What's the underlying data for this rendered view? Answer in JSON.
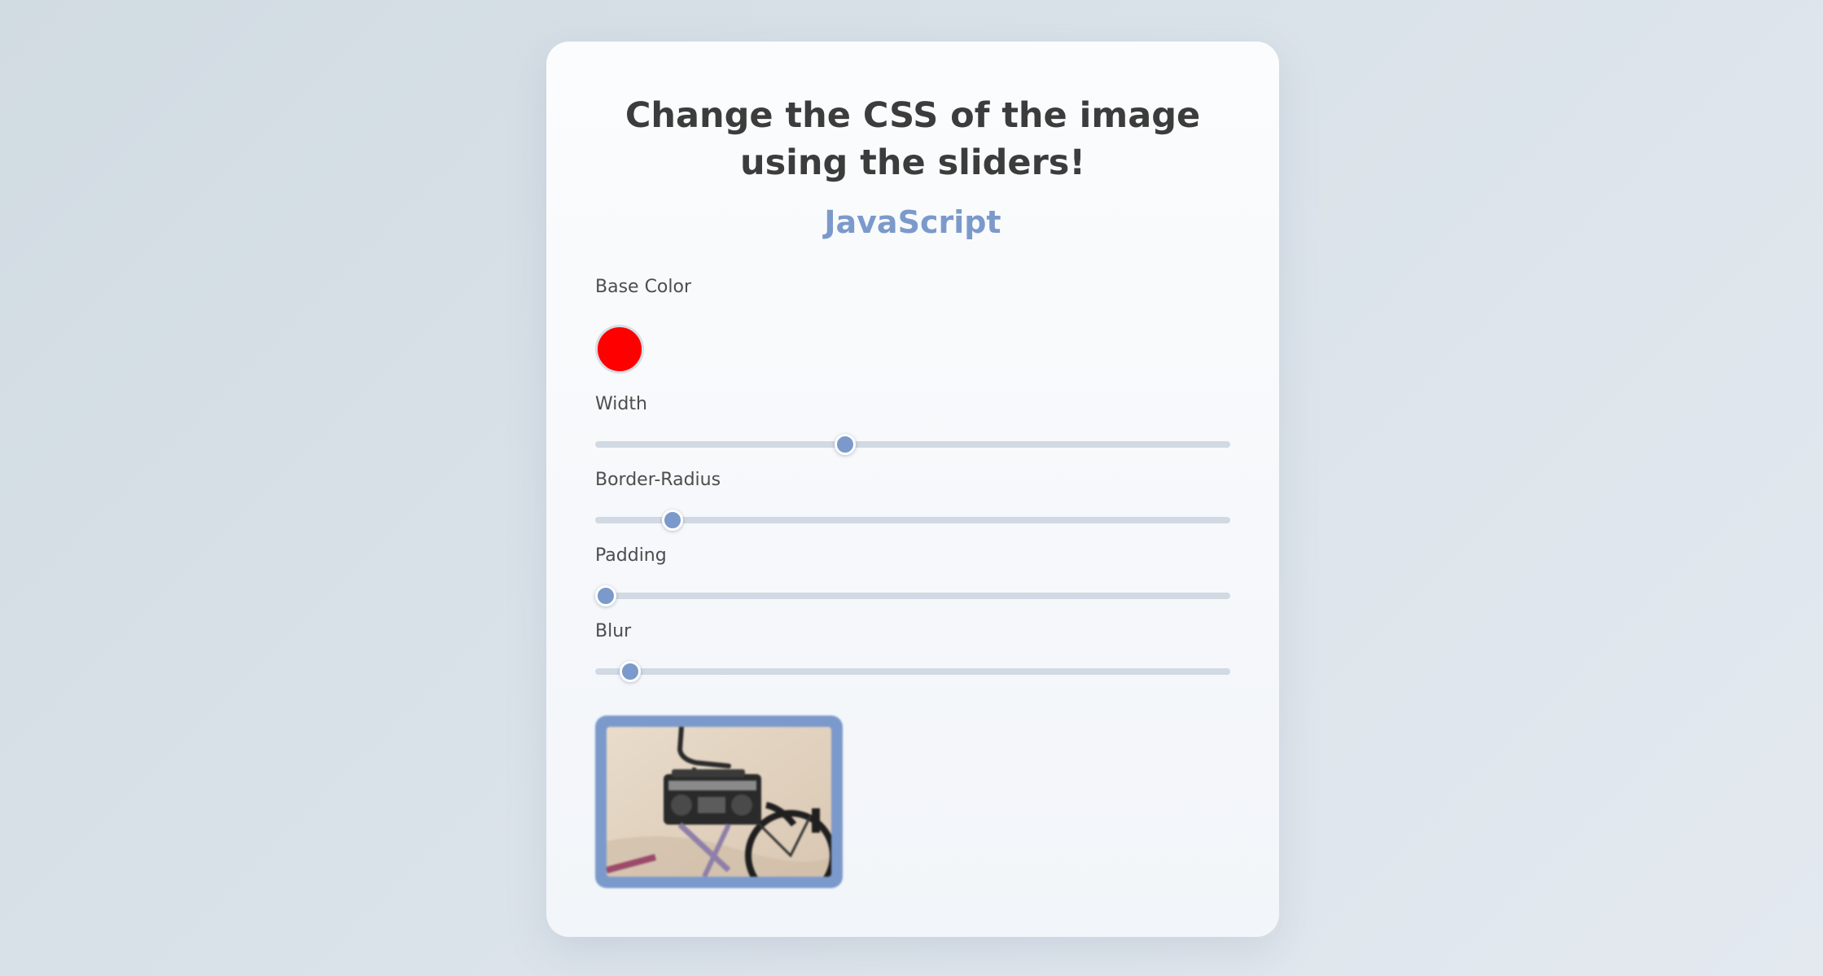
{
  "heading": {
    "title": "Change the CSS of the image using the sliders!",
    "subtitle": "JavaScript"
  },
  "controls": {
    "base_color": {
      "label": "Base Color",
      "value": "#ff0000"
    },
    "width": {
      "label": "Width",
      "fraction": 0.393
    },
    "border_radius": {
      "label": "Border-Radius",
      "fraction": 0.122
    },
    "padding": {
      "label": "Padding",
      "fraction": 0.017
    },
    "blur": {
      "label": "Blur",
      "fraction": 0.055
    }
  },
  "colors": {
    "accent": "#7b9acb",
    "title_text": "#3c3c3c",
    "track": "#d1d9e3"
  },
  "preview_image": {
    "description_icon": "bicycle-boombox-photo"
  }
}
